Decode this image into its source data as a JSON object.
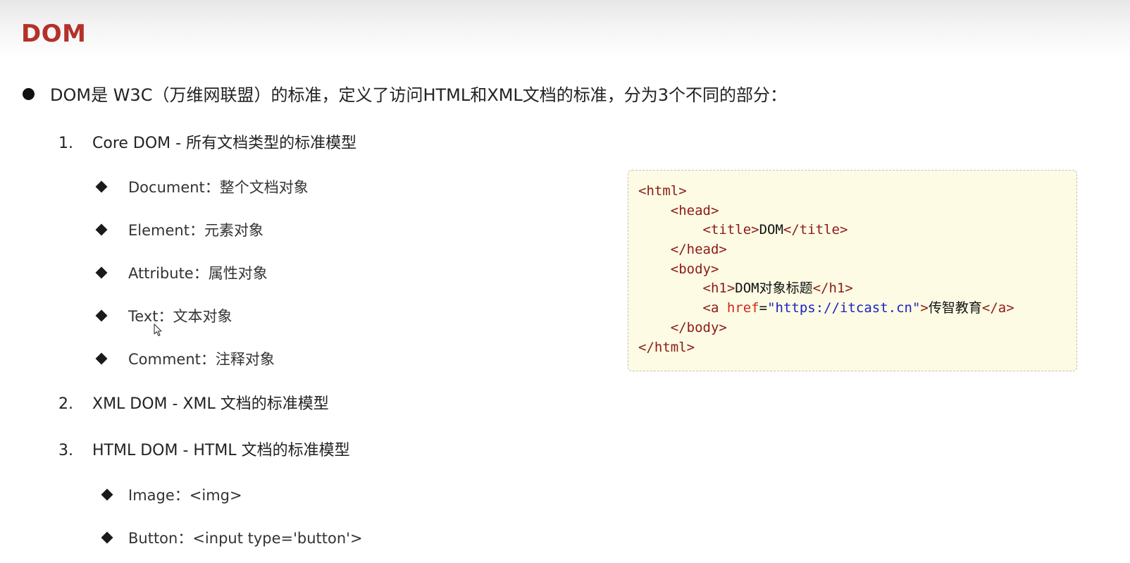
{
  "slide": {
    "title": "DOM",
    "intro": "DOM是 W3C（万维网联盟）的标准，定义了访问HTML和XML文档的标准，分为3个不同的部分："
  },
  "parts": [
    {
      "number": "1.",
      "label": "Core DOM - 所有文档类型的标准模型",
      "items": [
        "Document：整个文档对象",
        "Element：元素对象",
        "Attribute：属性对象",
        "Text：文本对象",
        "Comment：注释对象"
      ]
    },
    {
      "number": "2.",
      "label": "XML DOM - XML 文档的标准模型"
    },
    {
      "number": "3.",
      "label": "HTML DOM - HTML 文档的标准模型",
      "items": [
        "Image：<img>",
        "Button：<input type='button'>"
      ]
    }
  ],
  "code": {
    "html_open": "<html>",
    "head_open": "<head>",
    "title_open": "<title>",
    "title_text": "DOM",
    "title_close": "</title>",
    "head_close": "</head>",
    "body_open": "<body>",
    "h1_open": "<h1>",
    "h1_text": "DOM对象标题",
    "h1_close": "</h1>",
    "a_open_start": "<a ",
    "a_attr_name": "href",
    "a_eq": "=",
    "a_attr_value": "\"https://itcast.cn\"",
    "a_open_end": ">",
    "a_text": "传智教育",
    "a_close": "</a>",
    "body_close": "</body>",
    "html_close": "</html>"
  },
  "colors": {
    "title": "#b3312a",
    "code_background": "#fdfbe3",
    "code_tag": "#8b1a1a",
    "code_attr": "#d4241e",
    "code_string": "#1a22c8"
  },
  "icons": {
    "main_bullet": "filled-circle",
    "sub_bullet": "filled-diamond",
    "cursor": "mouse-pointer-arrow"
  }
}
